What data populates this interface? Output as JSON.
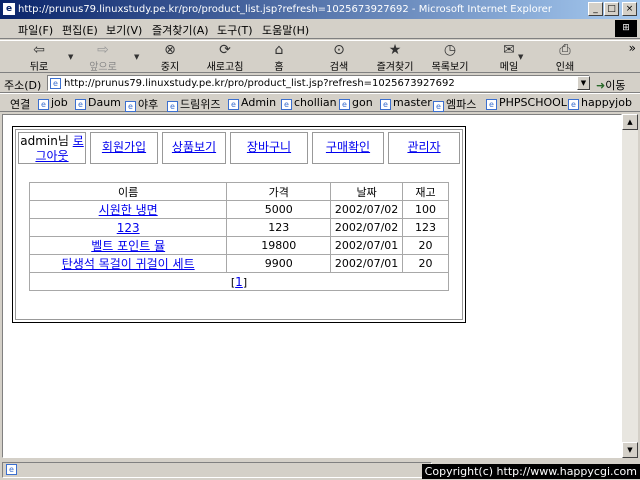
{
  "window": {
    "title": "http://prunus79.linuxstudy.pe.kr/pro/product_list.jsp?refresh=1025673927692 - Microsoft Internet Explorer",
    "minimize": "_",
    "maximize": "□",
    "close": "×"
  },
  "menu": {
    "items": [
      "파일(F)",
      "편집(E)",
      "보기(V)",
      "즐겨찾기(A)",
      "도구(T)",
      "도움말(H)"
    ]
  },
  "toolbar": {
    "back": "뒤로",
    "forward": "앞으로",
    "stop": "중지",
    "refresh": "새로고침",
    "home": "홈",
    "search": "검색",
    "favorites": "즐겨찾기",
    "history": "목록보기",
    "mail": "메일",
    "print": "인쇄",
    "more": "»"
  },
  "address": {
    "label": "주소(D)",
    "url": "http://prunus79.linuxstudy.pe.kr/pro/product_list.jsp?refresh=1025673927692",
    "go": "이동"
  },
  "links": {
    "label": "연결",
    "items": [
      "job",
      "Daum",
      "야후",
      "드림위즈",
      "Admin",
      "chollian",
      "gon",
      "master",
      "엠파스",
      "PHPSCHOOL",
      "happyjob"
    ]
  },
  "status": {
    "copyright": "Copyright(c) http://www.happycgi.com"
  },
  "page": {
    "nav": {
      "user": "admin님",
      "logout": "로그아웃",
      "join": "회원가입",
      "products": "상품보기",
      "cart": "장바구니",
      "orders": "구매확인",
      "admin": "관리자"
    },
    "table": {
      "headers": [
        "이름",
        "가격",
        "날짜",
        "재고"
      ],
      "rows": [
        {
          "name": "시원한 냉면",
          "price": "5000",
          "date": "2002/07/02",
          "stock": "100"
        },
        {
          "name": "123",
          "price": "123",
          "date": "2002/07/02",
          "stock": "123"
        },
        {
          "name": "벨트 포인트 뮬",
          "price": "19800",
          "date": "2002/07/01",
          "stock": "20"
        },
        {
          "name": "탄생석 목걸이 귀걸이 세트",
          "price": "9900",
          "date": "2002/07/01",
          "stock": "20"
        }
      ],
      "pager": {
        "open": "[",
        "page": "1",
        "close": "]"
      }
    }
  }
}
